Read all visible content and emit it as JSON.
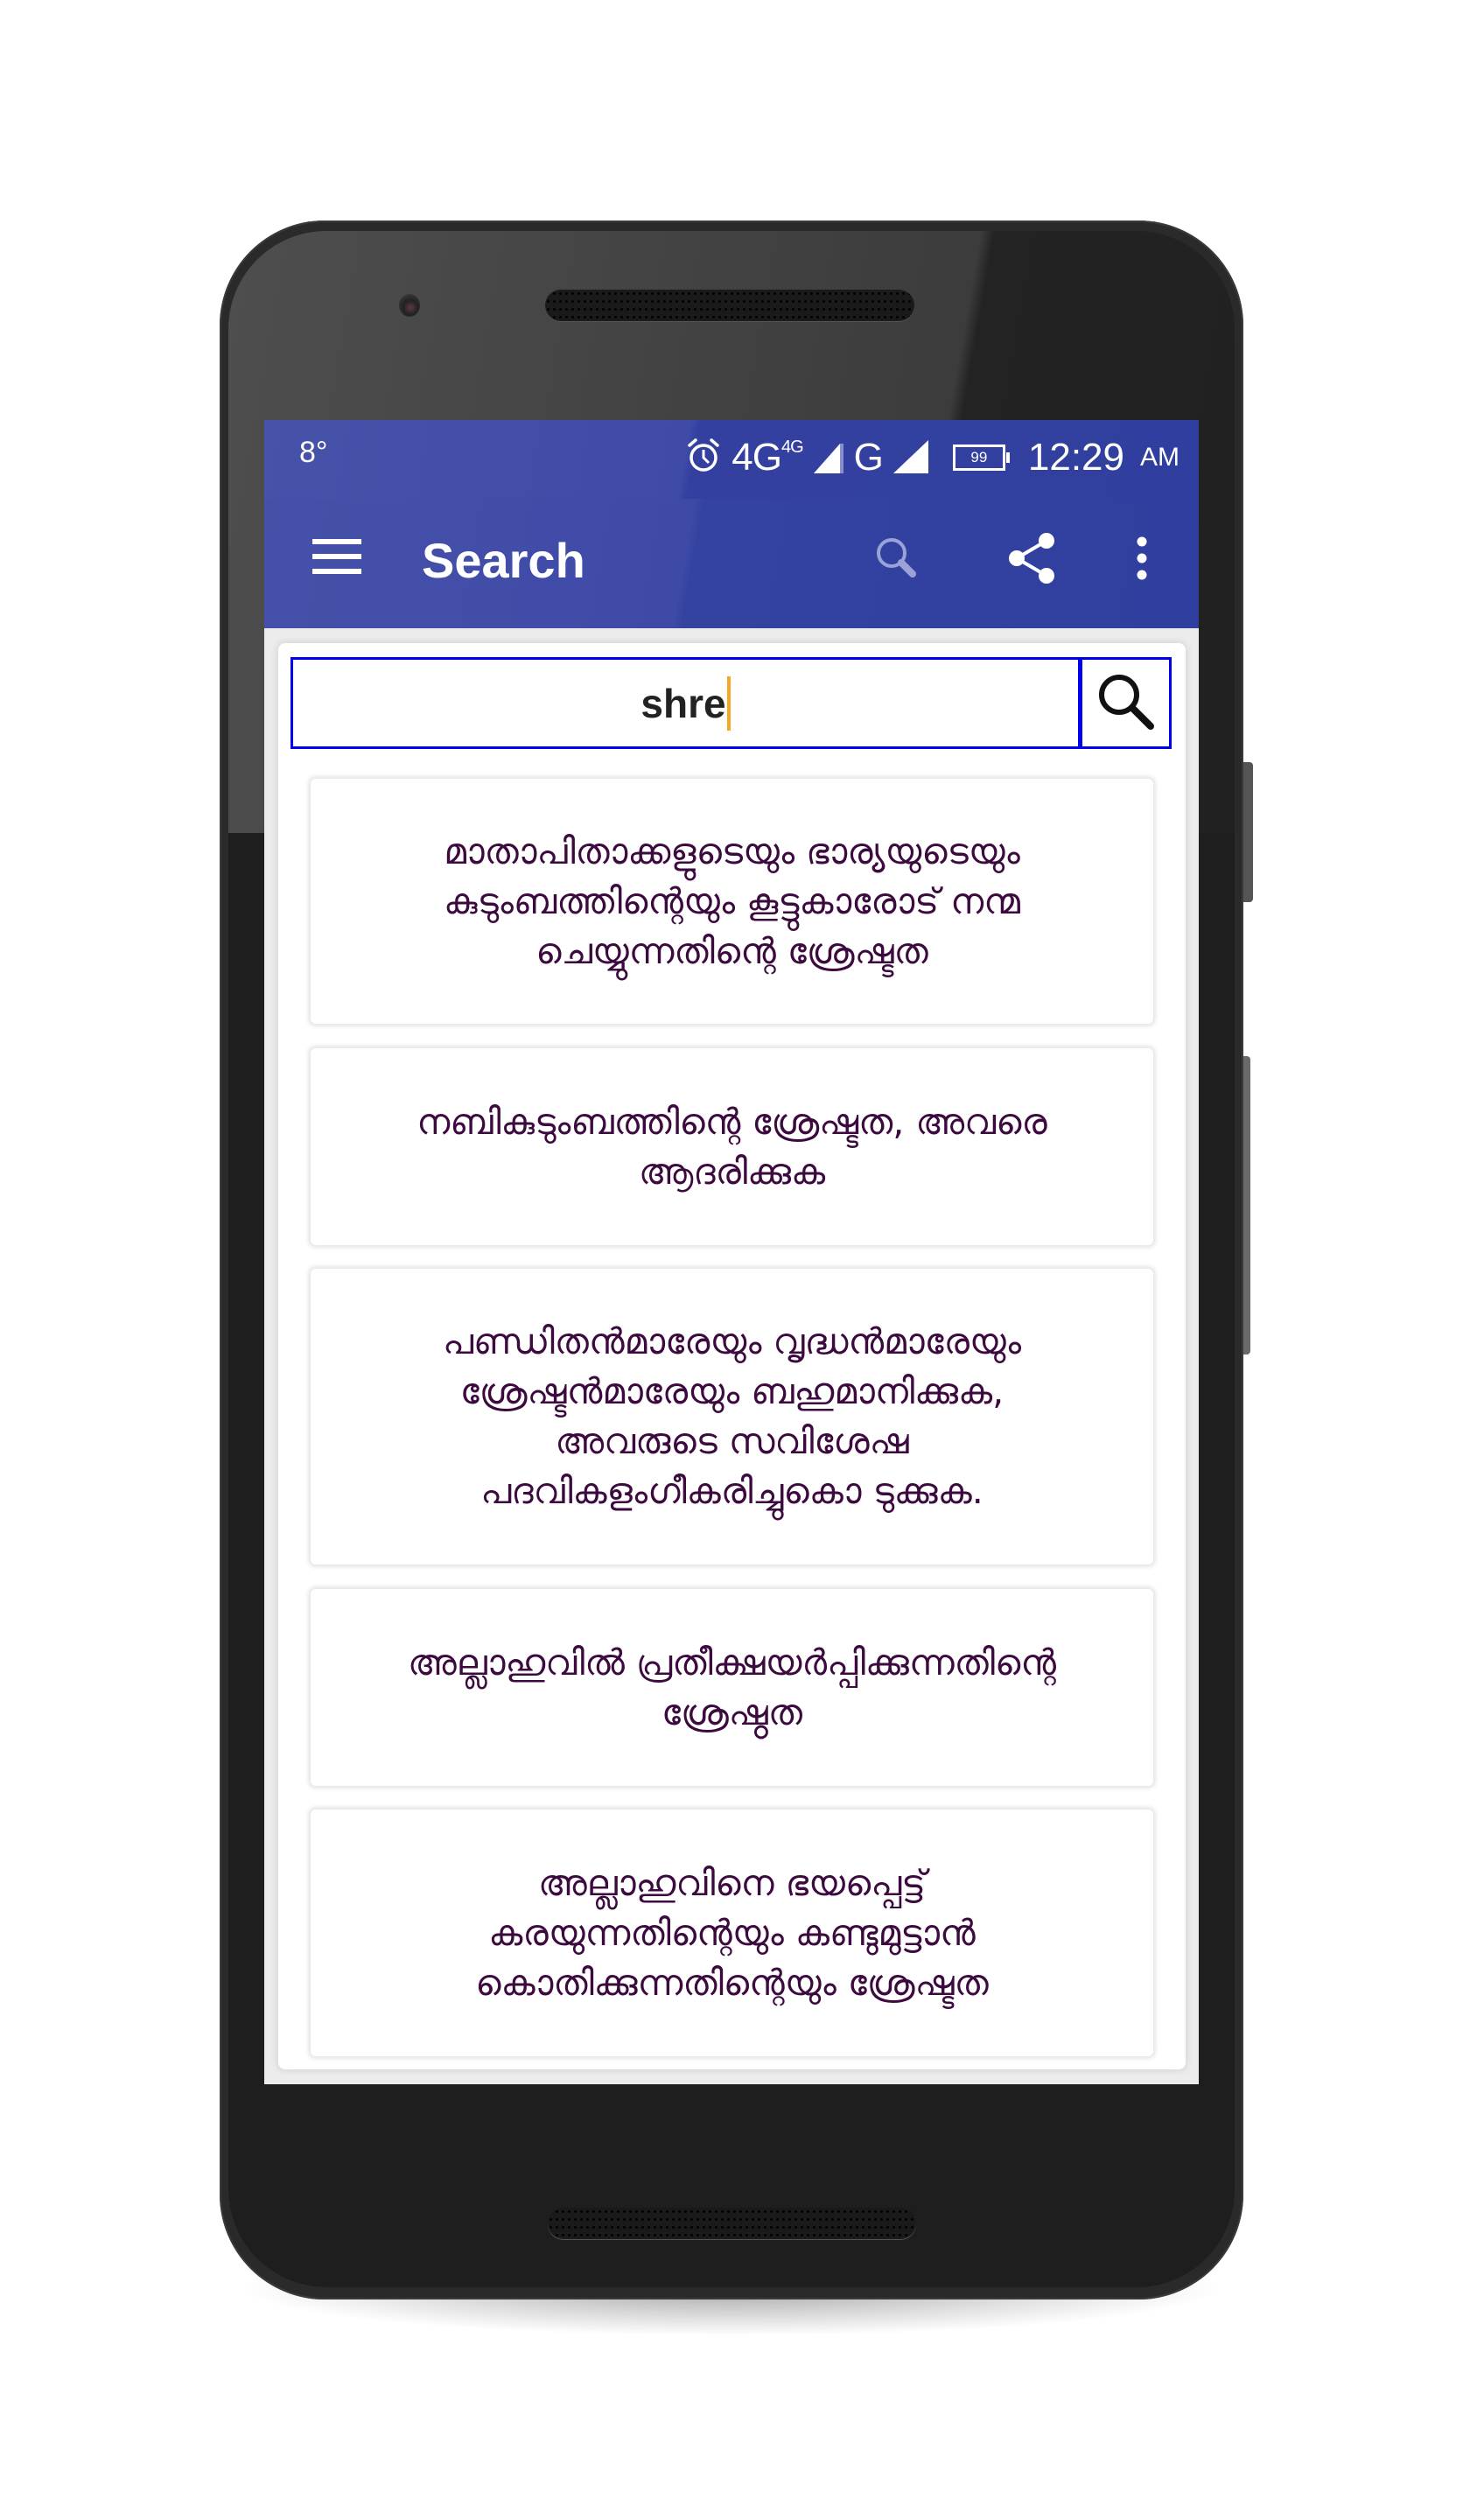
{
  "status_bar": {
    "temperature": "8°",
    "network_primary": "4G",
    "network_primary_sup": "4G",
    "network_secondary": "G",
    "battery_level": "99",
    "time": "12:29",
    "ampm": "AM",
    "icons": [
      "alarm-icon",
      "signal-icon",
      "signal-icon",
      "battery-icon"
    ]
  },
  "app_bar": {
    "title": "Search",
    "menu_icon": "hamburger-menu-icon",
    "actions": [
      "search-icon",
      "share-icon",
      "overflow-menu-icon"
    ]
  },
  "search": {
    "value": "shre",
    "button_icon": "search-icon"
  },
  "colors": {
    "app_bar": "#303f9f",
    "search_border": "#0000ee",
    "result_text": "#3d0a3f",
    "caret": "#f5a623"
  },
  "results": [
    {
      "text": "മാതാപിതാക്കളുടെയും ഭാര്യയുടെയും കുടുംബത്തിന്റെയും കൂട്ടുകാരോട് നന്മ ചെയ്യുന്നതിന്റെ ശ്രേഷ്ടത"
    },
    {
      "text": "നബികുടുംബത്തിന്റെ ശ്രേഷ്ടത, അവരെ ആദരിക്കുക"
    },
    {
      "text": "പണ്ഡിതൻമാരേയും വൃദ്ധൻമാരേയും ശ്രേഷ്ടൻമാരേയും ബഹുമാനിക്കുക, അവരുടെ സവിശേഷ പദവികളംഗീകരിച്ചുകൊ ടുക്കുക."
    },
    {
      "text": "അല്ലാഹുവിൽ പ്രതീക്ഷയർപ്പിക്കുന്നതിന്റെ ശ്രേഷ്ഠത"
    },
    {
      "text": "അല്ലാഹുവിനെ ഭയപ്പെട്ട് കരയുന്നതിന്റെയും കണ്ടുമുട്ടാൻ കൊതിക്കുന്നതിന്റെയും ശ്രേഷ്ടത"
    }
  ]
}
